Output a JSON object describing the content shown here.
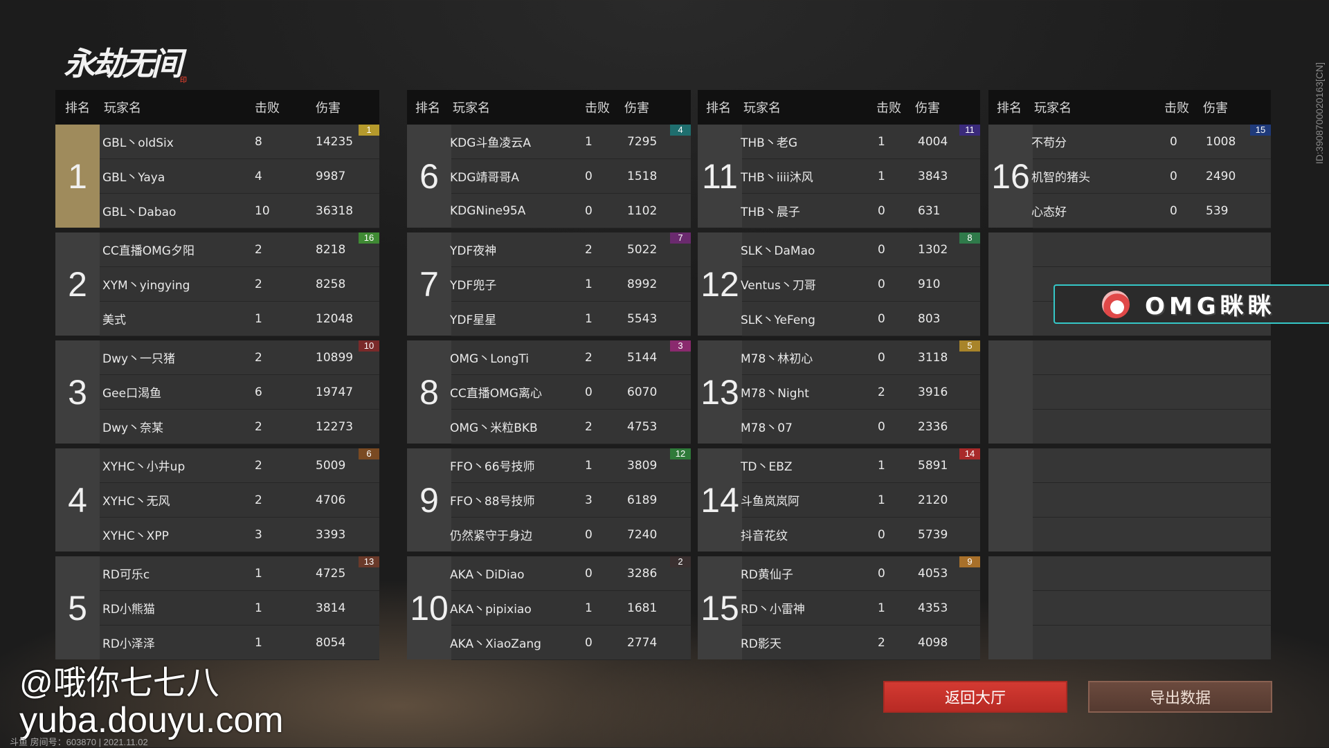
{
  "logo": {
    "text": "永劫无间",
    "seal": "印"
  },
  "side_id": "ID:3908700020163[CN]",
  "headers": {
    "rank": "排名",
    "player": "玩家名",
    "kills": "击败",
    "damage": "伤害"
  },
  "teams": [
    {
      "rank": "1",
      "badge": "1",
      "badge_color": "#b59a2c",
      "players": [
        {
          "name": "GBL丶oldSix",
          "kills": "8",
          "damage": "14235"
        },
        {
          "name": "GBL丶Yaya",
          "kills": "4",
          "damage": "9987"
        },
        {
          "name": "GBL丶Dabao",
          "kills": "10",
          "damage": "36318"
        }
      ]
    },
    {
      "rank": "2",
      "badge": "16",
      "badge_color": "#3f8a34",
      "players": [
        {
          "name": "CC直播OMG夕阳",
          "kills": "2",
          "damage": "8218"
        },
        {
          "name": "XYM丶yingying",
          "kills": "2",
          "damage": "8258"
        },
        {
          "name": "美式",
          "kills": "1",
          "damage": "12048"
        }
      ]
    },
    {
      "rank": "3",
      "badge": "10",
      "badge_color": "#7a2a2a",
      "players": [
        {
          "name": "Dwy丶一只猪",
          "kills": "2",
          "damage": "10899"
        },
        {
          "name": "Gee口渴鱼",
          "kills": "6",
          "damage": "19747"
        },
        {
          "name": "Dwy丶奈某",
          "kills": "2",
          "damage": "12273"
        }
      ]
    },
    {
      "rank": "4",
      "badge": "6",
      "badge_color": "#7a4a22",
      "players": [
        {
          "name": "XYHC丶小井up",
          "kills": "2",
          "damage": "5009"
        },
        {
          "name": "XYHC丶无风",
          "kills": "2",
          "damage": "4706"
        },
        {
          "name": "XYHC丶XPP",
          "kills": "3",
          "damage": "3393"
        }
      ]
    },
    {
      "rank": "5",
      "badge": "13",
      "badge_color": "#6a3a2a",
      "players": [
        {
          "name": "RD可乐c",
          "kills": "1",
          "damage": "4725"
        },
        {
          "name": "RD小熊猫",
          "kills": "1",
          "damage": "3814"
        },
        {
          "name": "RD小泽泽",
          "kills": "1",
          "damage": "8054"
        }
      ]
    },
    {
      "rank": "6",
      "badge": "4",
      "badge_color": "#1f6e6e",
      "players": [
        {
          "name": "KDG斗鱼凌云A",
          "kills": "1",
          "damage": "7295"
        },
        {
          "name": "KDG靖哥哥A",
          "kills": "0",
          "damage": "1518"
        },
        {
          "name": "KDGNine95A",
          "kills": "0",
          "damage": "1102"
        }
      ]
    },
    {
      "rank": "7",
      "badge": "7",
      "badge_color": "#6a2a6e",
      "players": [
        {
          "name": "YDF夜神",
          "kills": "2",
          "damage": "5022"
        },
        {
          "name": "YDF兜子",
          "kills": "1",
          "damage": "8992"
        },
        {
          "name": "YDF星星",
          "kills": "1",
          "damage": "5543"
        }
      ]
    },
    {
      "rank": "8",
      "badge": "3",
      "badge_color": "#8a2a6e",
      "players": [
        {
          "name": "OMG丶LongTi",
          "kills": "2",
          "damage": "5144"
        },
        {
          "name": "CC直播OMG离心",
          "kills": "0",
          "damage": "6070"
        },
        {
          "name": "OMG丶米粒BKB",
          "kills": "2",
          "damage": "4753"
        }
      ]
    },
    {
      "rank": "9",
      "badge": "12",
      "badge_color": "#2f7a3a",
      "players": [
        {
          "name": "FFO丶66号技师",
          "kills": "1",
          "damage": "3809"
        },
        {
          "name": "FFO丶88号技师",
          "kills": "3",
          "damage": "6189"
        },
        {
          "name": "仍然紧守于身边",
          "kills": "0",
          "damage": "7240"
        }
      ]
    },
    {
      "rank": "10",
      "badge": "2",
      "badge_color": "#3a3030",
      "players": [
        {
          "name": "AKA丶DiDiao",
          "kills": "0",
          "damage": "3286"
        },
        {
          "name": "AKA丶pipixiao",
          "kills": "1",
          "damage": "1681"
        },
        {
          "name": "AKA丶XiaoZang",
          "kills": "0",
          "damage": "2774"
        }
      ]
    },
    {
      "rank": "11",
      "badge": "11",
      "badge_color": "#3a2a7a",
      "players": [
        {
          "name": "THB丶老G",
          "kills": "1",
          "damage": "4004"
        },
        {
          "name": "THB丶iiii沐风",
          "kills": "1",
          "damage": "3843"
        },
        {
          "name": "THB丶晨子",
          "kills": "0",
          "damage": "631"
        }
      ]
    },
    {
      "rank": "12",
      "badge": "8",
      "badge_color": "#2f7a4a",
      "players": [
        {
          "name": "SLK丶DaMao",
          "kills": "0",
          "damage": "1302"
        },
        {
          "name": "Ventus丶刀哥",
          "kills": "0",
          "damage": "910"
        },
        {
          "name": "SLK丶YeFeng",
          "kills": "0",
          "damage": "803"
        }
      ]
    },
    {
      "rank": "13",
      "badge": "5",
      "badge_color": "#a8842a",
      "players": [
        {
          "name": "M78丶林初心",
          "kills": "0",
          "damage": "3118"
        },
        {
          "name": "M78丶Night",
          "kills": "2",
          "damage": "3916"
        },
        {
          "name": "M78丶07",
          "kills": "0",
          "damage": "2336"
        }
      ]
    },
    {
      "rank": "14",
      "badge": "14",
      "badge_color": "#a82a2a",
      "players": [
        {
          "name": "TD丶EBZ",
          "kills": "1",
          "damage": "5891"
        },
        {
          "name": "斗鱼岚岚阿",
          "kills": "1",
          "damage": "2120"
        },
        {
          "name": "抖音花纹",
          "kills": "0",
          "damage": "5739"
        }
      ]
    },
    {
      "rank": "15",
      "badge": "9",
      "badge_color": "#a8702a",
      "players": [
        {
          "name": "RD黄仙子",
          "kills": "0",
          "damage": "4053"
        },
        {
          "name": "RD丶小雷神",
          "kills": "1",
          "damage": "4353"
        },
        {
          "name": "RD影天",
          "kills": "2",
          "damage": "4098"
        }
      ]
    },
    {
      "rank": "16",
      "badge": "15",
      "badge_color": "#1f3a7a",
      "players": [
        {
          "name": "不苟分",
          "kills": "0",
          "damage": "1008"
        },
        {
          "name": "机智的猪头",
          "kills": "0",
          "damage": "2490"
        },
        {
          "name": "心态好",
          "kills": "0",
          "damage": "539"
        }
      ]
    }
  ],
  "streamer_banner": {
    "icon": "weibo-icon",
    "name": "OMG眯眯"
  },
  "buttons": {
    "return_lobby": "返回大厅",
    "export_data": "导出数据"
  },
  "watermark": {
    "handle": "@哦你七七八",
    "site": "yuba.douyu.com"
  },
  "room_info": "斗鱼 房间号：603870 | 2021.11.02"
}
